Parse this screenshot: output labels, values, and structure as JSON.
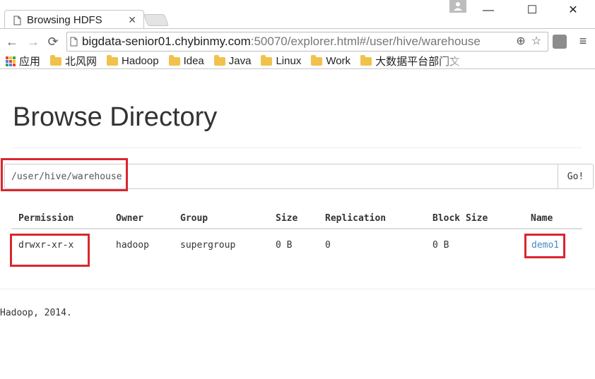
{
  "browser": {
    "tab_title": "Browsing HDFS",
    "url_host": "bigdata-senior01.chybinmy.com",
    "url_rest": ":50070/explorer.html#/user/hive/warehouse",
    "window_controls": {
      "minimize": "—",
      "maximize": "☐",
      "close": "✕"
    },
    "nav": {
      "back": "←",
      "forward": "→",
      "reload": "⟳"
    },
    "bookmarks": [
      {
        "label": "应用",
        "icon": "apps-icon"
      },
      {
        "label": "北风网",
        "icon": "folder-icon"
      },
      {
        "label": "Hadoop",
        "icon": "folder-icon"
      },
      {
        "label": "Idea",
        "icon": "folder-icon"
      },
      {
        "label": "Java",
        "icon": "folder-icon"
      },
      {
        "label": "Linux",
        "icon": "folder-icon"
      },
      {
        "label": "Work",
        "icon": "folder-icon"
      },
      {
        "label": "大数据平台部门文",
        "icon": "folder-icon"
      }
    ]
  },
  "page": {
    "title": "Browse Directory",
    "path_value": "/user/hive/warehouse",
    "go_label": "Go!",
    "columns": [
      "Permission",
      "Owner",
      "Group",
      "Size",
      "Replication",
      "Block Size",
      "Name"
    ],
    "rows": [
      {
        "permission": "drwxr-xr-x",
        "owner": "hadoop",
        "group": "supergroup",
        "size": "0 B",
        "replication": "0",
        "block_size": "0 B",
        "name": "demo1"
      }
    ],
    "footer": "Hadoop, 2014."
  },
  "colors": {
    "highlight": "#d9272e",
    "link": "#428bca"
  }
}
